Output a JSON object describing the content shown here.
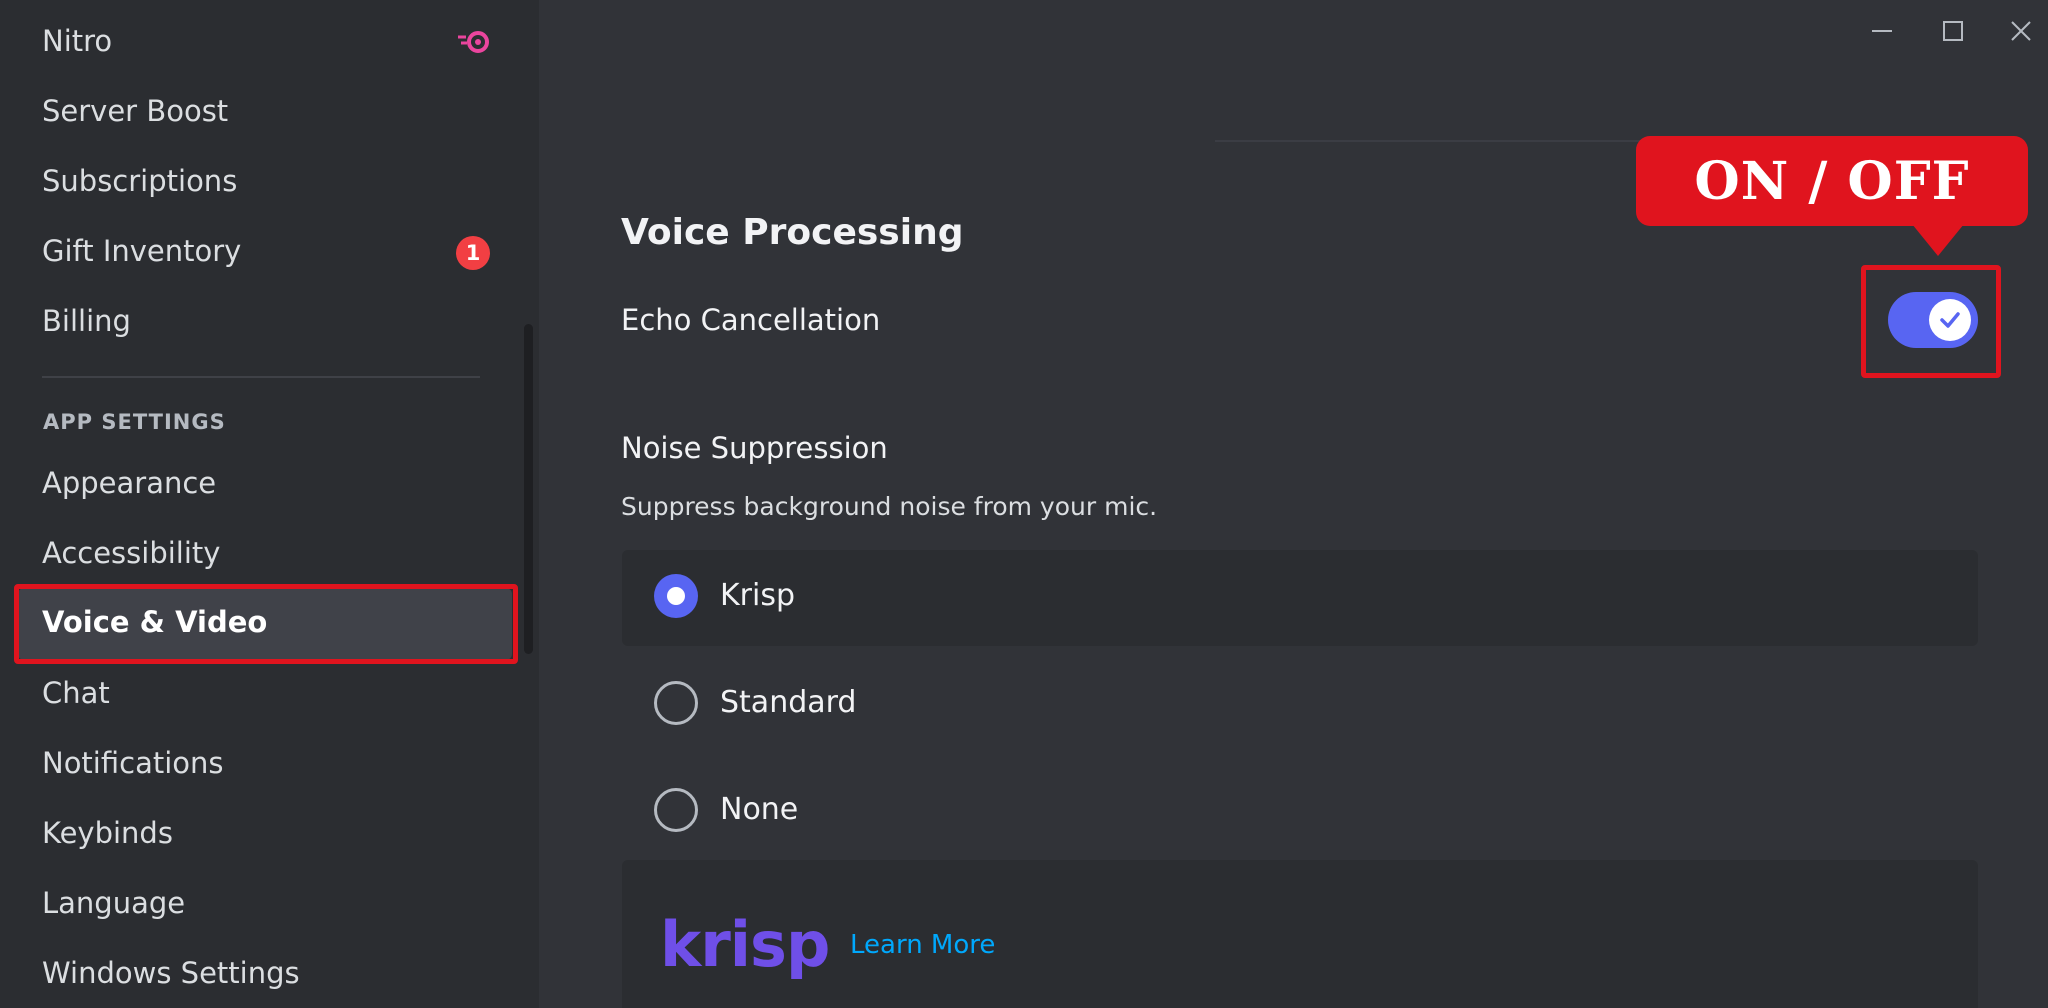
{
  "sidebar": {
    "items": [
      {
        "label": "Nitro"
      },
      {
        "label": "Server Boost"
      },
      {
        "label": "Subscriptions"
      },
      {
        "label": "Gift Inventory",
        "badge": "1"
      },
      {
        "label": "Billing"
      }
    ],
    "section_header": "APP SETTINGS",
    "app_items": [
      {
        "label": "Appearance"
      },
      {
        "label": "Accessibility"
      },
      {
        "label": "Voice & Video",
        "selected": true
      },
      {
        "label": "Chat"
      },
      {
        "label": "Notifications"
      },
      {
        "label": "Keybinds"
      },
      {
        "label": "Language"
      },
      {
        "label": "Windows Settings"
      }
    ]
  },
  "main": {
    "section_title": "Voice Processing",
    "echo_cancellation": {
      "label": "Echo Cancellation",
      "enabled": true
    },
    "noise_suppression": {
      "label": "Noise Suppression",
      "description": "Suppress background noise from your mic.",
      "options": [
        {
          "label": "Krisp",
          "selected": true
        },
        {
          "label": "Standard",
          "selected": false
        },
        {
          "label": "None",
          "selected": false
        }
      ]
    },
    "krisp_promo": {
      "logo_text": "krisp",
      "link": "Learn More"
    }
  },
  "annotation": {
    "callout_text": "ON / OFF",
    "color": "#e0141e"
  },
  "colors": {
    "accent": "#5865f2",
    "sidebar_bg": "#2b2d31",
    "main_bg": "#313338",
    "badge": "#f23f43"
  }
}
